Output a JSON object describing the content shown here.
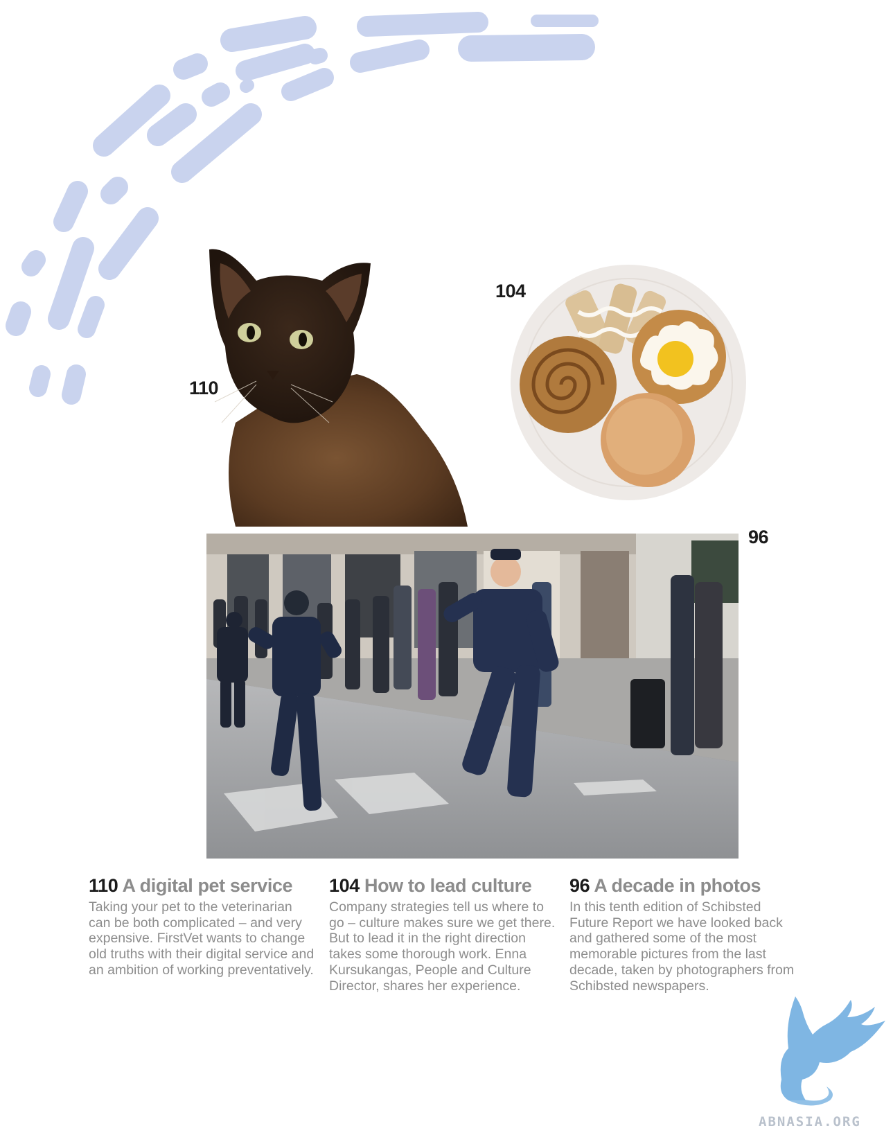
{
  "page_numbers": {
    "cat": "110",
    "pastries": "104",
    "photo": "96"
  },
  "articles": [
    {
      "number": "110",
      "title": "A digital pet service",
      "body": "Taking your pet to the veterinarian can be both complicated – and very expensive. FirstVet wants to change old truths with their digital service and an ambition of working preventatively."
    },
    {
      "number": "104",
      "title": "How to lead culture",
      "body": "Company strategies tell us where to go – culture makes sure we get there. But to lead it in the right direction takes some thorough work. Enna Kursukangas, People and Culture Director, shares her experience."
    },
    {
      "number": "96",
      "title": "A decade in photos",
      "body": "In this tenth edition of Schibsted Future Report we have looked back and gathered some of the most memorable pictures from the last decade, taken by photographers from Schibsted newspapers."
    }
  ],
  "watermark": {
    "text": "ABNASIA.ORG",
    "icon": "griffin-logo-icon"
  },
  "colors": {
    "accent_dash": "#c9d3ee",
    "number_dark": "#1b1b1b",
    "title_gray": "#8c8c8c",
    "body_gray": "#8d8d8d",
    "watermark_blue": "#7fb6e3"
  }
}
